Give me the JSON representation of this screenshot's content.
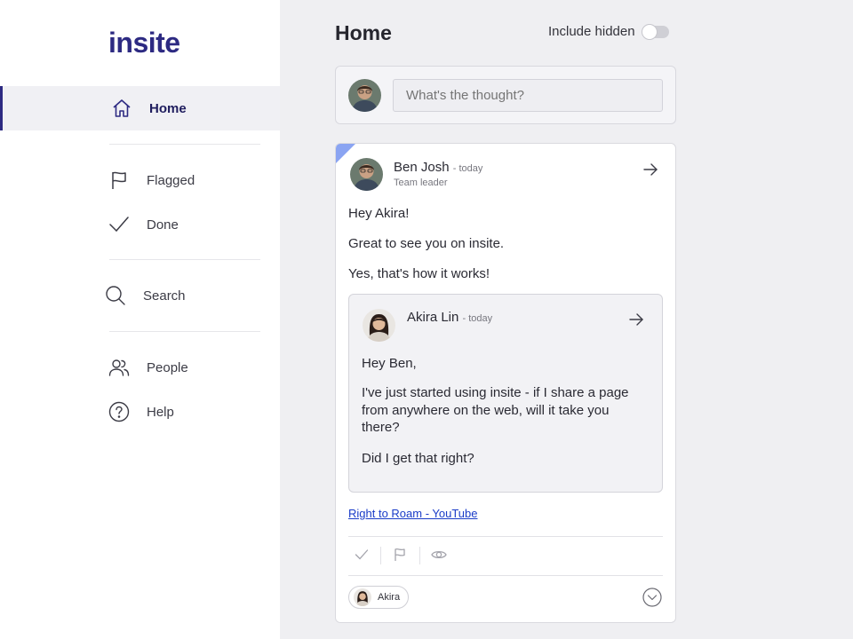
{
  "app": {
    "logo_text": "insite",
    "brand_color": "#2d2a82",
    "accent_color": "#8aa4f2"
  },
  "sidebar": {
    "items": [
      {
        "label": "Home",
        "icon": "home-icon",
        "active": true
      },
      {
        "label": "Flagged",
        "icon": "flag-icon"
      },
      {
        "label": "Done",
        "icon": "check-icon"
      },
      {
        "label": "Search",
        "icon": "search-icon"
      },
      {
        "label": "People",
        "icon": "people-icon"
      },
      {
        "label": "Help",
        "icon": "help-icon"
      }
    ]
  },
  "header": {
    "title": "Home",
    "include_hidden_label": "Include hidden",
    "include_hidden_on": false
  },
  "compose": {
    "placeholder": "What's the thought?"
  },
  "post": {
    "author": "Ben Josh",
    "time": "- today",
    "role": "Team leader",
    "lines": [
      "Hey Akira!",
      "Great to see you on insite.",
      "Yes, that's how it works!"
    ],
    "quoted": {
      "author": "Akira Lin",
      "time": "- today",
      "lines": [
        "Hey Ben,",
        "I've just started using insite - if I share a page from anywhere on the web, will it take you there?",
        "Did I get that right?"
      ]
    },
    "link_text": "Right to Roam - YouTube",
    "recipient_chip": "Akira"
  }
}
